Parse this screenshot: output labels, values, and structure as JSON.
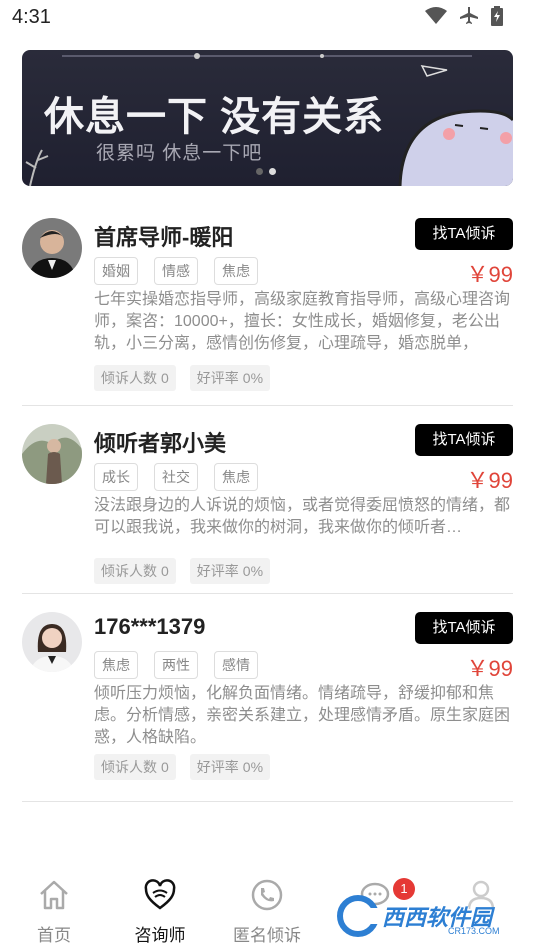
{
  "status_bar": {
    "time": "4:31"
  },
  "banner": {
    "title": "休息一下 没有关系",
    "subtitle": "很累吗 休息一下吧"
  },
  "counselors": [
    {
      "name": "首席导师-暖阳",
      "cta": "找TA倾诉",
      "price": "￥99",
      "tags": [
        "婚姻",
        "情感",
        "焦虑"
      ],
      "description": "七年实操婚恋指导师，高级家庭教育指导师，高级心理咨询师，案咨：10000+，擅长：女性成长，婚姻修复，老公出轨，小三分离，感情创伤修复，心理疏导，婚恋脱单，",
      "stats": [
        {
          "label": "倾诉人数",
          "value": "0"
        },
        {
          "label": "好评率",
          "value": "0%"
        }
      ]
    },
    {
      "name": "倾听者郭小美",
      "cta": "找TA倾诉",
      "price": "￥99",
      "tags": [
        "成长",
        "社交",
        "焦虑"
      ],
      "description": "没法跟身边的人诉说的烦恼，或者觉得委屈愤怒的情绪，都可以跟我说，我来做你的树洞，我来做你的倾听者…",
      "stats": [
        {
          "label": "倾诉人数",
          "value": "0"
        },
        {
          "label": "好评率",
          "value": "0%"
        }
      ]
    },
    {
      "name": "176***1379",
      "cta": "找TA倾诉",
      "price": "￥99",
      "tags": [
        "焦虑",
        "两性",
        "感情"
      ],
      "description": "倾听压力烦恼，化解负面情绪。情绪疏导，舒缓抑郁和焦虑。分析情感，亲密关系建立，处理感情矛盾。原生家庭困惑，人格缺陷。",
      "stats": [
        {
          "label": "倾诉人数",
          "value": "0"
        },
        {
          "label": "好评率",
          "value": "0%"
        }
      ]
    }
  ],
  "tabbar": {
    "items": [
      {
        "label": "首页",
        "icon": "home-icon"
      },
      {
        "label": "咨询师",
        "icon": "counselor-icon"
      },
      {
        "label": "匿名倾诉",
        "icon": "phone-icon"
      },
      {
        "label": "",
        "icon": "chat-icon",
        "badge": "1"
      },
      {
        "label": "",
        "icon": "profile-icon"
      }
    ],
    "active_index": 1
  },
  "watermark": {
    "text": "西西软件园",
    "url_text": "CR173.COM"
  },
  "colors": {
    "price": "#e0453a",
    "cta_bg": "#000000",
    "badge": "#e53935"
  }
}
